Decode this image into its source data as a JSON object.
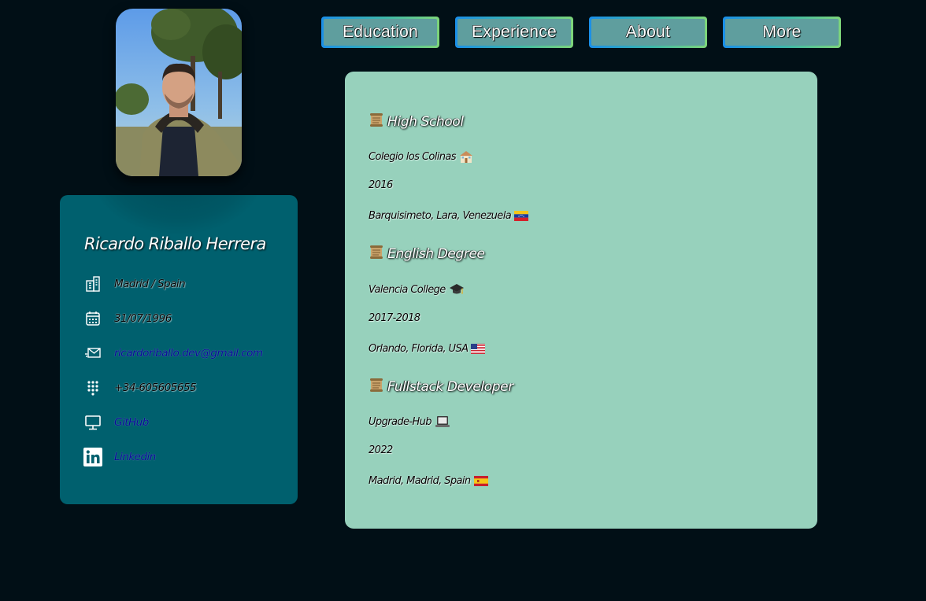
{
  "nav": {
    "buttons": [
      {
        "label": "Education"
      },
      {
        "label": "Experience"
      },
      {
        "label": "About"
      },
      {
        "label": "More"
      }
    ]
  },
  "profile": {
    "name": "Ricardo Riballo Herrera",
    "items": [
      {
        "icon": "building-icon",
        "text": "Madrid / Spain"
      },
      {
        "icon": "calendar-icon",
        "text": "31/07/1996"
      },
      {
        "icon": "mail-icon",
        "text": "ricardoriballo.dev@gmail.com"
      },
      {
        "icon": "dialpad-icon",
        "text": "+34-605605655"
      },
      {
        "icon": "monitor-icon",
        "text": "GitHub"
      },
      {
        "icon": "linkedin-icon",
        "text": "Linkedin"
      }
    ]
  },
  "education": [
    {
      "title": "High School",
      "school": "Colegio los Colinas",
      "school_icon": "school-icon",
      "year": "2016",
      "location": "Barquisimeto, Lara, Venezuela",
      "flag": "venezuela-flag-icon"
    },
    {
      "title": "English Degree",
      "school": "Valencia College",
      "school_icon": "graduation-cap-icon",
      "year": "2017-2018",
      "location": "Orlando, Florida, USA",
      "flag": "usa-flag-icon"
    },
    {
      "title": "Fullstack Developer",
      "school": "Upgrade-Hub",
      "school_icon": "laptop-icon",
      "year": "2022",
      "location": "Madrid, Madrid, Spain",
      "flag": "spain-flag-icon"
    }
  ],
  "colors": {
    "background": "#010f16",
    "card": "#00606e",
    "panel": "#97d1bc",
    "button_face": "#5f9e9e",
    "link": "#0a0a9a"
  }
}
